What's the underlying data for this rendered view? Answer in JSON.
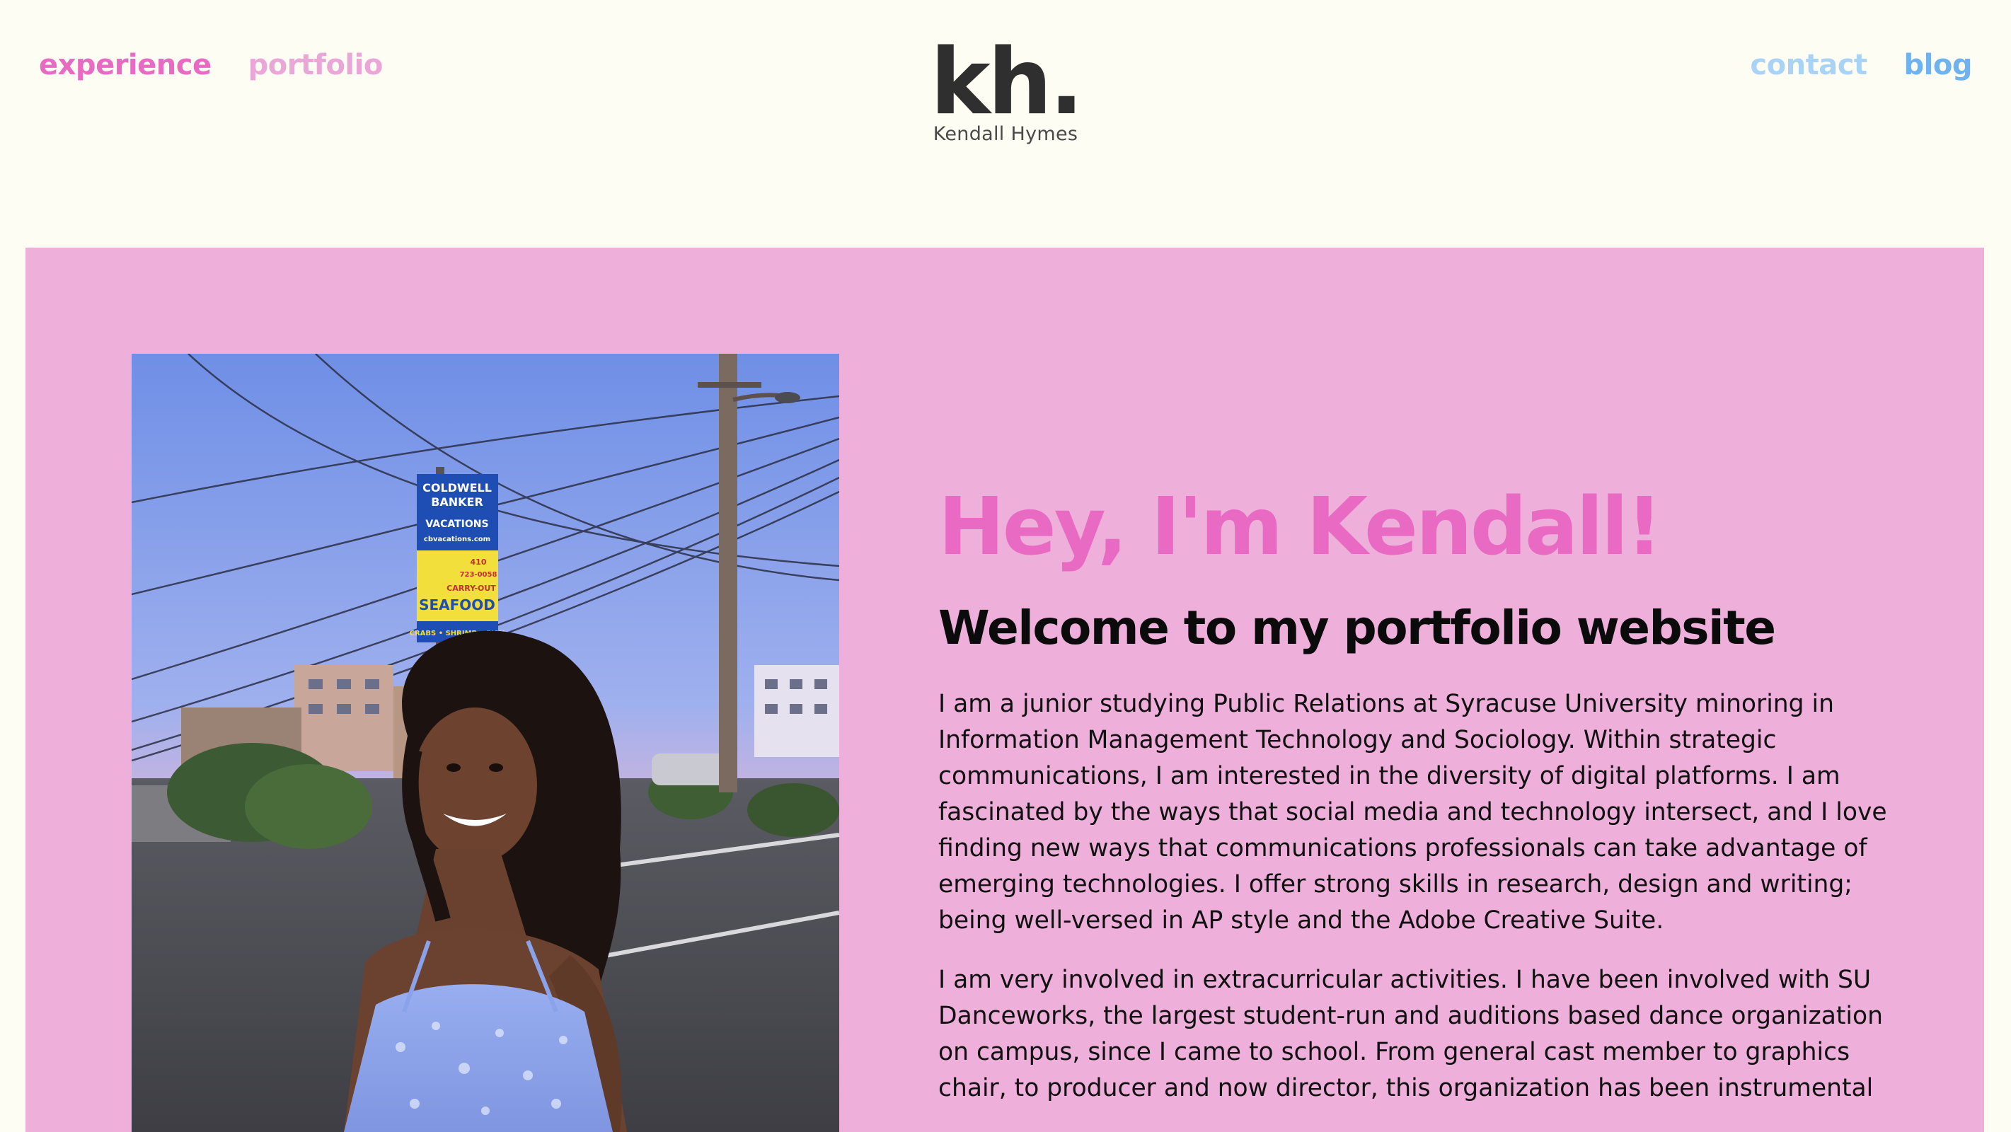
{
  "colors": {
    "page_background": "#fdfdf3",
    "hero_background": "#eeb0da",
    "accent_pink": "#e96ac3",
    "light_pink": "#eba6d8",
    "light_blue": "#a9d3f6",
    "blue": "#6fb2f0",
    "text_dark": "#0b0b0b"
  },
  "nav": {
    "left": [
      {
        "label": "experience",
        "color": "#e96ac3"
      },
      {
        "label": "portfolio",
        "color": "#eba6d8"
      }
    ],
    "right": [
      {
        "label": "contact",
        "color": "#a9d3f6"
      },
      {
        "label": "blog",
        "color": "#6fb2f0"
      }
    ]
  },
  "logo": {
    "mark": "kh.",
    "name": "Kendall Hymes"
  },
  "hero": {
    "title": "Hey, I'm Kendall!",
    "subtitle": "Welcome to my portfolio website",
    "paragraphs": [
      "I am a junior studying Public Relations at Syracuse University minoring in Information Management Technology and Sociology. Within strategic communications, I am interested in the diversity of digital platforms. I am fascinated by the ways that social media and technology intersect, and I love finding new ways that communications professionals can take advantage of emerging technologies. I offer strong skills in research, design and writing; being well-versed in AP style and the Adobe Creative Suite.",
      "I am very involved in extracurricular activities. I have been involved with SU Danceworks, the largest student-run and auditions based dance organization on campus, since I came to school. From general cast member to graphics chair, to producer and now director, this organization has been instrumental"
    ],
    "photo": {
      "sign_lines": [
        "COLDWELL",
        "BANKER",
        "VACATIONS",
        "cbvacations.com",
        "410",
        "723-0058",
        "CARRY-OUT",
        "SEAFOOD",
        "CRABS • SHRIMP • FISH"
      ]
    }
  }
}
